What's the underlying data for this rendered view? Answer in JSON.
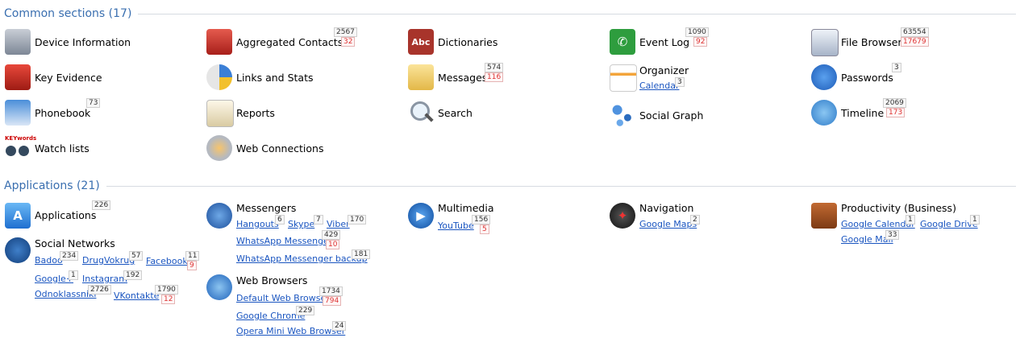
{
  "sections": {
    "common": {
      "title": "Common sections (17)"
    },
    "applications": {
      "title": "Applications (21)"
    }
  },
  "common": {
    "device_information": {
      "label": "Device Information"
    },
    "aggregated_contacts": {
      "label": "Aggregated Contacts",
      "count": "2567",
      "new": "32"
    },
    "dictionaries": {
      "label": "Dictionaries"
    },
    "event_log": {
      "label": "Event Log",
      "count": "1090",
      "new": "92"
    },
    "file_browser": {
      "label": "File Browser",
      "count": "63554",
      "new": "17679"
    },
    "key_evidence": {
      "label": "Key Evidence"
    },
    "links_and_stats": {
      "label": "Links and Stats"
    },
    "messages": {
      "label": "Messages",
      "count": "574",
      "new": "116"
    },
    "organizer": {
      "label": "Organizer",
      "sub_label": "Calendar",
      "sub_count": "3"
    },
    "passwords": {
      "label": "Passwords",
      "count": "3"
    },
    "phonebook": {
      "label": "Phonebook",
      "count": "73"
    },
    "reports": {
      "label": "Reports"
    },
    "search": {
      "label": "Search"
    },
    "social_graph": {
      "label": "Social Graph"
    },
    "timeline": {
      "label": "Timeline",
      "count": "2069",
      "new": "173"
    },
    "watch_lists": {
      "label": "Watch lists",
      "icon_text": "KEYwords"
    },
    "web_connections": {
      "label": "Web Connections"
    }
  },
  "apps": {
    "applications": {
      "label": "Applications",
      "count": "226"
    },
    "messengers": {
      "label": "Messengers",
      "hangouts": {
        "label": "Hangouts",
        "count": "6"
      },
      "skype": {
        "label": "Skype",
        "count": "7"
      },
      "viber": {
        "label": "Viber",
        "count": "170"
      },
      "whatsapp": {
        "label": "WhatsApp Messenger",
        "count": "429",
        "new": "10"
      },
      "whatsapp_backup": {
        "label": "WhatsApp Messenger backup",
        "count": "181"
      }
    },
    "multimedia": {
      "label": "Multimedia",
      "youtube": {
        "label": "YouTube",
        "count": "156",
        "new": "5"
      }
    },
    "navigation": {
      "label": "Navigation",
      "maps": {
        "label": "Google Maps",
        "count": "2"
      }
    },
    "productivity": {
      "label": "Productivity (Business)",
      "calendar": {
        "label": "Google Calendar",
        "count": "1"
      },
      "drive": {
        "label": "Google Drive",
        "count": "1"
      },
      "mail": {
        "label": "Google Mail",
        "count": "33"
      }
    },
    "social": {
      "label": "Social Networks",
      "badoo": {
        "label": "Badoo",
        "count": "234"
      },
      "drugvokrug": {
        "label": "DrugVokrug",
        "count": "57"
      },
      "facebook": {
        "label": "Facebook",
        "count": "11",
        "new": "9"
      },
      "googleplus": {
        "label": "Google+",
        "count": "1"
      },
      "instagram": {
        "label": "Instagram",
        "count": "192"
      },
      "odnoklassniki": {
        "label": "Odnoklassniki",
        "count": "2726"
      },
      "vkontakte": {
        "label": "VKontakte",
        "count": "1790",
        "new": "12"
      }
    },
    "browsers": {
      "label": "Web Browsers",
      "default": {
        "label": "Default Web Browser",
        "count": "1734",
        "new": "794"
      },
      "chrome": {
        "label": "Google Chrome",
        "count": "229"
      },
      "opera": {
        "label": "Opera Mini Web Browser",
        "count": "24"
      }
    }
  },
  "colors": {
    "accent": "#3a6fb0",
    "link": "#1a55c0",
    "new_count": "#d33"
  }
}
